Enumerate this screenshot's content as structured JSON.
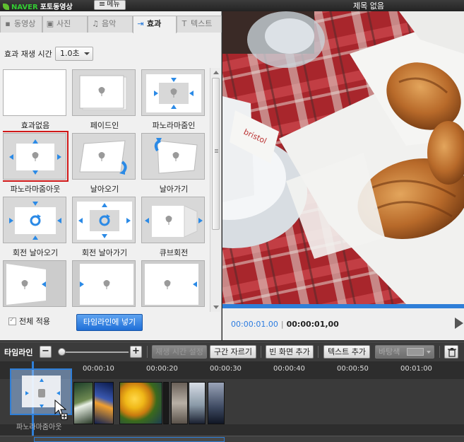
{
  "app": {
    "logo_brand": "NAVER",
    "logo_name": "포토동영상",
    "menu_label": "메뉴",
    "document_title": "제목 없음"
  },
  "tabs": [
    {
      "label": "동영상",
      "icon": "film-icon"
    },
    {
      "label": "사진",
      "icon": "photo-icon"
    },
    {
      "label": "음악",
      "icon": "music-icon"
    },
    {
      "label": "효과",
      "icon": "transition-icon",
      "active": true
    },
    {
      "label": "텍스트",
      "icon": "text-icon"
    }
  ],
  "effects_panel": {
    "duration_label": "효과 재생 시간",
    "duration_value": "1.0초",
    "effects": [
      {
        "label": "효과없음",
        "kind": "none"
      },
      {
        "label": "페이드인",
        "kind": "fade"
      },
      {
        "label": "파노라마줌인",
        "kind": "zoom-in"
      },
      {
        "label": "파노라마줌아웃",
        "kind": "zoom-out",
        "selected": true
      },
      {
        "label": "날아오기",
        "kind": "fly-in"
      },
      {
        "label": "날아가기",
        "kind": "fly-out"
      },
      {
        "label": "회전 날아오기",
        "kind": "spin-in"
      },
      {
        "label": "회전 날아가기",
        "kind": "spin-out"
      },
      {
        "label": "큐브회전",
        "kind": "cube"
      },
      {
        "label": "",
        "kind": "page-left"
      },
      {
        "label": "",
        "kind": "slide-right"
      },
      {
        "label": "",
        "kind": "slide-left"
      }
    ],
    "apply_all_label": "전체 적용",
    "apply_all_checked": true,
    "put_button_label": "타임라인에 넣기"
  },
  "preview": {
    "current_time": "00:00:01.00",
    "separator": "|",
    "total_time": "00:00:01,00"
  },
  "timeline": {
    "title": "타임라인",
    "zoom_out_label": "−",
    "zoom_in_label": "+",
    "buttons": {
      "duration_setting": "재생 시간 설정",
      "split": "구간 자르기",
      "blank_screen": "빈 화면 추가",
      "add_text": "텍스트 추가",
      "bg_color": "바탕색"
    },
    "ruler_labels": [
      "00:00:10",
      "00:00:20",
      "00:00:30",
      "00:00:40",
      "00:00:50",
      "00:01:00"
    ],
    "drag_label": "파노라마줌아웃"
  },
  "colors": {
    "accent": "#2f7fd8",
    "selection": "#d01818",
    "arrow": "#2b8ae6"
  }
}
